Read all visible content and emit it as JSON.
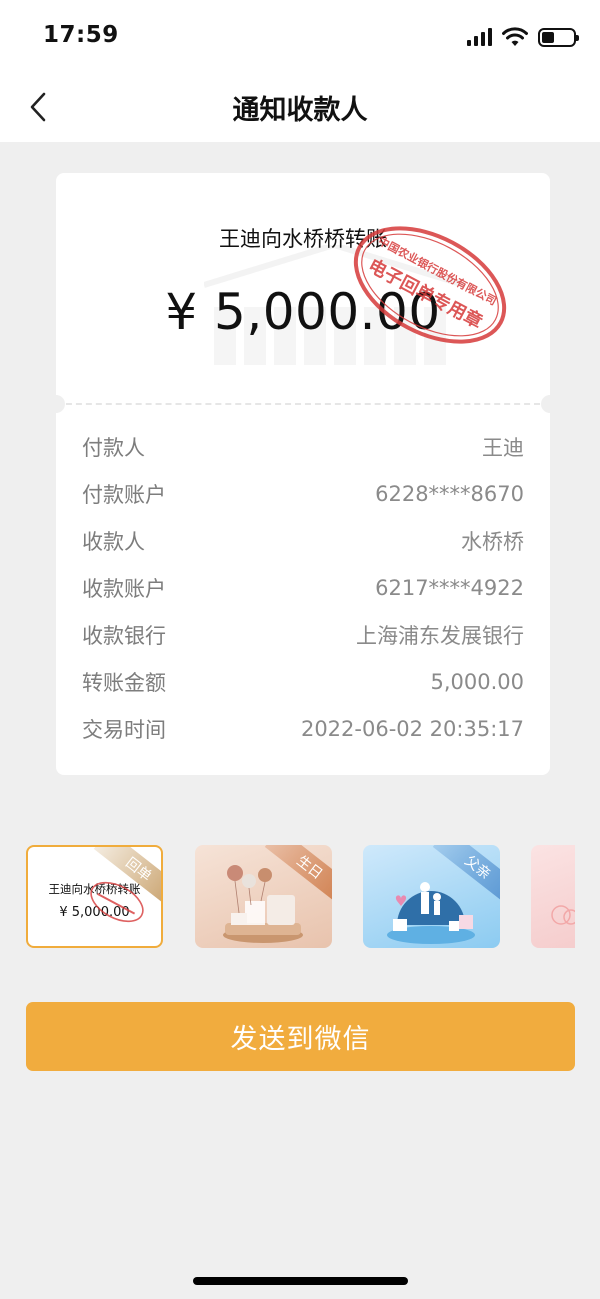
{
  "status_bar": {
    "time": "17:59",
    "icons": [
      "cellular-signal-icon",
      "wifi-icon",
      "battery-icon"
    ],
    "battery_level": 0.4
  },
  "nav": {
    "title": "通知收款人",
    "back_icon": "chevron-left-icon"
  },
  "receipt": {
    "title": "王迪向水桥桥转账",
    "amount": "¥ 5,000.00",
    "stamp": {
      "bank_text": "中国农业银行股份有限公司",
      "seal_text": "电子回单专用章",
      "color": "#d63a3a"
    },
    "details": [
      {
        "label": "付款人",
        "value": "王迪"
      },
      {
        "label": "付款账户",
        "value": "6228****8670"
      },
      {
        "label": "收款人",
        "value": "水桥桥"
      },
      {
        "label": "收款账户",
        "value": "6217****4922"
      },
      {
        "label": "收款银行",
        "value": "上海浦东发展银行"
      },
      {
        "label": "转账金额",
        "value": "5,000.00"
      },
      {
        "label": "交易时间",
        "value": "2022-06-02 20:35:17"
      }
    ]
  },
  "templates": [
    {
      "tag": "回单",
      "title": "王迪向水桥桥转账",
      "amount": "¥ 5,000.00",
      "selected": true
    },
    {
      "tag": "生日",
      "selected": false
    },
    {
      "tag": "父亲",
      "selected": false
    }
  ],
  "send_button": {
    "label": "发送到微信",
    "color": "#f1ac3e"
  },
  "colors": {
    "background": "#efefef",
    "accent": "#f1ac3e",
    "stamp_red": "#d63a3a"
  }
}
